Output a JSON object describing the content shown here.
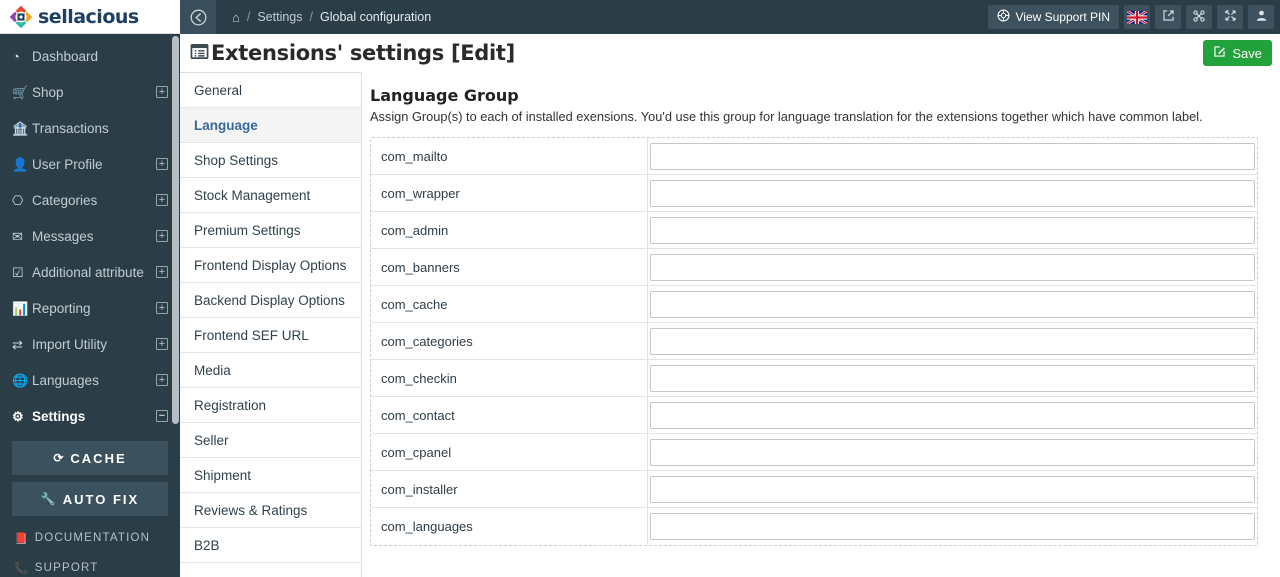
{
  "brand": {
    "name": "sellacious"
  },
  "sidebar": {
    "items": [
      {
        "label": "Dashboard",
        "icon": "dashboard-gauge-icon",
        "glyph": "◔",
        "expandable": false,
        "active": false
      },
      {
        "label": "Shop",
        "icon": "shopping-cart-icon",
        "glyph": "🛒",
        "expandable": true,
        "active": false
      },
      {
        "label": "Transactions",
        "icon": "bank-icon",
        "glyph": "🏦",
        "expandable": false,
        "active": false
      },
      {
        "label": "User Profile",
        "icon": "user-icon",
        "glyph": "👤",
        "expandable": true,
        "active": false
      },
      {
        "label": "Categories",
        "icon": "sitemap-icon",
        "glyph": "⎔",
        "expandable": true,
        "active": false
      },
      {
        "label": "Messages",
        "icon": "envelope-icon",
        "glyph": "✉",
        "expandable": true,
        "active": false
      },
      {
        "label": "Additional attribute",
        "icon": "checkbox-icon",
        "glyph": "☑",
        "expandable": true,
        "active": false
      },
      {
        "label": "Reporting",
        "icon": "bar-chart-icon",
        "glyph": "📊",
        "expandable": true,
        "active": false
      },
      {
        "label": "Import Utility",
        "icon": "exchange-arrows-icon",
        "glyph": "⇄",
        "expandable": true,
        "active": false
      },
      {
        "label": "Languages",
        "icon": "globe-icon",
        "glyph": "🌐",
        "expandable": true,
        "active": false
      },
      {
        "label": "Settings",
        "icon": "gear-icon",
        "glyph": "⚙",
        "expandable": true,
        "expanded": true,
        "active": true
      }
    ],
    "buttons": [
      {
        "label": "CACHE",
        "icon": "refresh-icon",
        "glyph": "⟳"
      },
      {
        "label": "AUTO FIX",
        "icon": "wrench-icon",
        "glyph": "🔧"
      }
    ],
    "links": [
      {
        "label": "DOCUMENTATION",
        "icon": "book-icon",
        "glyph": "📕"
      },
      {
        "label": "SUPPORT",
        "icon": "phone-icon",
        "glyph": "📞"
      }
    ]
  },
  "topbar": {
    "back_icon": "back-arrow-circle-icon",
    "breadcrumb": {
      "home_icon": "home-icon",
      "separator": "/",
      "items": [
        "Settings",
        "Global configuration"
      ]
    },
    "support_pin": {
      "label": "View Support PIN",
      "icon": "lifebuoy-icon"
    },
    "tools": [
      {
        "name": "language-flag-uk",
        "label": "English (UK)"
      },
      {
        "name": "external-link-icon",
        "glyph": "↗"
      },
      {
        "name": "joomla-icon",
        "glyph": "⌘"
      },
      {
        "name": "fullscreen-icon",
        "glyph": "⤢"
      },
      {
        "name": "account-icon",
        "glyph": "👤"
      }
    ]
  },
  "page": {
    "title": "Extensions' settings [Edit]",
    "title_icon": "list-window-icon",
    "save_button": {
      "label": "Save",
      "icon": "edit-square-icon",
      "color": "#21a23a"
    }
  },
  "tabs": {
    "active": "Language",
    "items": [
      "General",
      "Language",
      "Shop Settings",
      "Stock Management",
      "Premium Settings",
      "Frontend Display Options",
      "Backend Display Options",
      "Frontend SEF URL",
      "Media",
      "Registration",
      "Seller",
      "Shipment",
      "Reviews & Ratings",
      "B2B"
    ]
  },
  "panel": {
    "heading": "Language Group",
    "description": "Assign Group(s) to each of installed exensions. You'd use this group for language translation for the extensions together which have common label.",
    "rows": [
      {
        "name": "com_mailto",
        "value": "",
        "placeholder": ""
      },
      {
        "name": "com_wrapper",
        "value": "",
        "placeholder": ""
      },
      {
        "name": "com_admin",
        "value": "",
        "placeholder": ""
      },
      {
        "name": "com_banners",
        "value": "",
        "placeholder": ""
      },
      {
        "name": "com_cache",
        "value": "",
        "placeholder": ""
      },
      {
        "name": "com_categories",
        "value": "",
        "placeholder": ""
      },
      {
        "name": "com_checkin",
        "value": "",
        "placeholder": ""
      },
      {
        "name": "com_contact",
        "value": "",
        "placeholder": ""
      },
      {
        "name": "com_cpanel",
        "value": "",
        "placeholder": ""
      },
      {
        "name": "com_installer",
        "value": "",
        "placeholder": ""
      },
      {
        "name": "com_languages",
        "value": "",
        "placeholder": ""
      }
    ]
  },
  "colors": {
    "sidebar_bg": "#2b3e48",
    "topbar_bg": "#2b3e48",
    "accent_blue": "#36699e",
    "save_green": "#21a23a",
    "brand_text": "#1c3f63"
  }
}
